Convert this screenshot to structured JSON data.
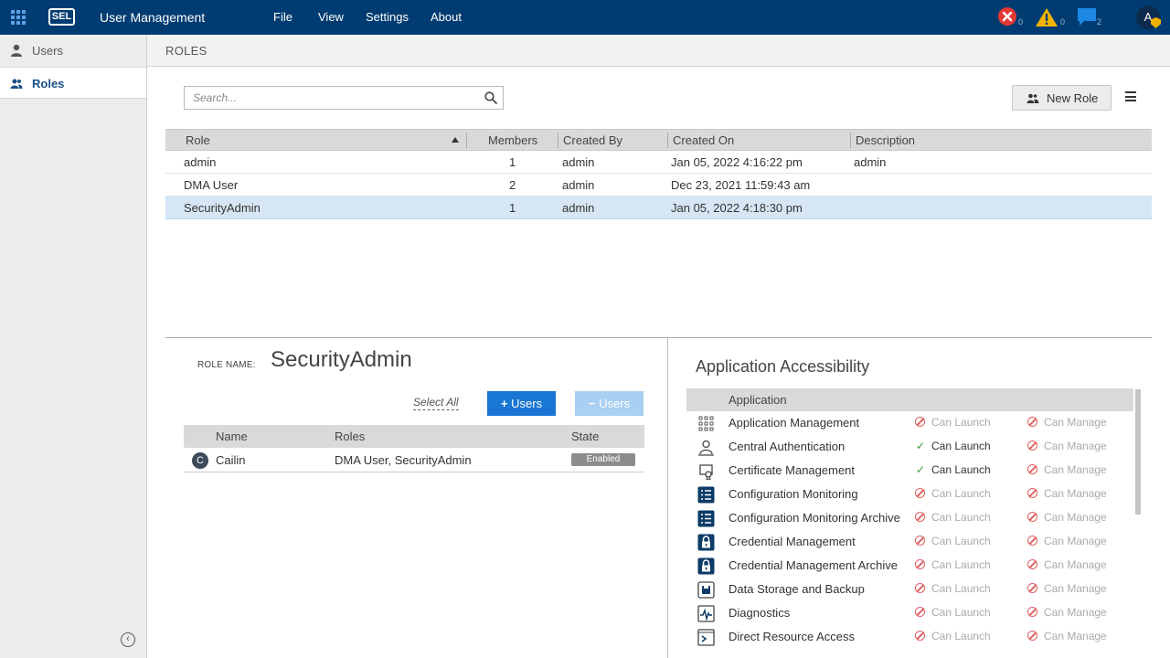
{
  "topbar": {
    "logo": "SEL",
    "app_title": "User Management",
    "menu": [
      "File",
      "View",
      "Settings",
      "About"
    ],
    "notifications": {
      "errors": "0",
      "warnings": "0",
      "messages": "2"
    },
    "user_initial": "A",
    "colors": {
      "bar": "#003c71",
      "error": "#e53935",
      "warning": "#f5b400",
      "message": "#1e88e5"
    }
  },
  "sidebar": {
    "items": [
      {
        "label": "Users",
        "icon": "user-icon"
      },
      {
        "label": "Roles",
        "icon": "users-group-icon",
        "active": true
      }
    ]
  },
  "page": {
    "title": "ROLES"
  },
  "search": {
    "placeholder": "Search...",
    "value": ""
  },
  "toolbar": {
    "new_role_label": "New Role"
  },
  "roles_table": {
    "columns": [
      "Role",
      "Members",
      "Created By",
      "Created On",
      "Description"
    ],
    "rows": [
      {
        "role": "admin",
        "members": "1",
        "created_by": "admin",
        "created_on": "Jan 05, 2022 4:16:22 pm",
        "description": "admin"
      },
      {
        "role": "DMA User",
        "members": "2",
        "created_by": "admin",
        "created_on": "Dec 23, 2021 11:59:43 am",
        "description": ""
      },
      {
        "role": "SecurityAdmin",
        "members": "1",
        "created_by": "admin",
        "created_on": "Jan 05, 2022 4:18:30 pm",
        "description": "",
        "selected": true
      }
    ]
  },
  "role_detail": {
    "label": "ROLE NAME:",
    "name": "SecurityAdmin",
    "select_all": "Select All",
    "add_users": "Users",
    "remove_users": "Users",
    "users_table": {
      "columns": [
        "Name",
        "Roles",
        "State"
      ],
      "rows": [
        {
          "initial": "C",
          "name": "Cailin",
          "roles": "DMA User, SecurityAdmin",
          "state": "Enabled"
        }
      ]
    }
  },
  "app_access": {
    "title": "Application Accessibility",
    "column": "Application",
    "launch_label": "Can Launch",
    "manage_label": "Can Manage",
    "apps": [
      {
        "name": "Application Management",
        "icon": "app-grid-icon",
        "can_launch": false,
        "can_manage": false
      },
      {
        "name": "Central Authentication",
        "icon": "central-auth-icon",
        "can_launch": true,
        "can_manage": false
      },
      {
        "name": "Certificate Management",
        "icon": "certificate-icon",
        "can_launch": true,
        "can_manage": false
      },
      {
        "name": "Configuration Monitoring",
        "icon": "config-list-icon",
        "can_launch": false,
        "can_manage": false
      },
      {
        "name": "Configuration Monitoring Archive",
        "icon": "config-list-icon",
        "can_launch": false,
        "can_manage": false
      },
      {
        "name": "Credential Management",
        "icon": "lock-icon",
        "can_launch": false,
        "can_manage": false
      },
      {
        "name": "Credential Management Archive",
        "icon": "lock-icon",
        "can_launch": false,
        "can_manage": false
      },
      {
        "name": "Data Storage and Backup",
        "icon": "storage-icon",
        "can_launch": false,
        "can_manage": false
      },
      {
        "name": "Diagnostics",
        "icon": "diagnostics-icon",
        "can_launch": false,
        "can_manage": false
      },
      {
        "name": "Direct Resource Access",
        "icon": "terminal-icon",
        "can_launch": false,
        "can_manage": false
      }
    ]
  }
}
